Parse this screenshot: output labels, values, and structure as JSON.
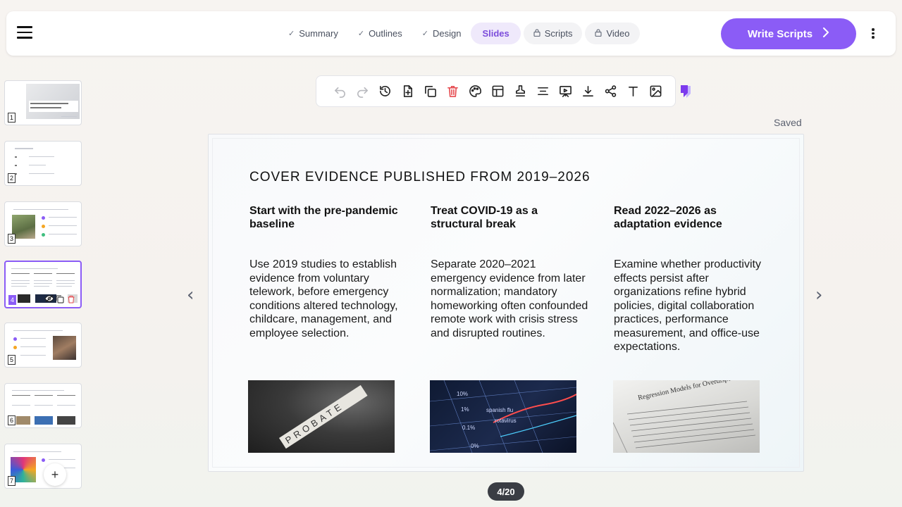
{
  "header": {
    "steps": [
      {
        "label": "Summary",
        "state": "done"
      },
      {
        "label": "Outlines",
        "state": "done"
      },
      {
        "label": "Design",
        "state": "done"
      },
      {
        "label": "Slides",
        "state": "active"
      },
      {
        "label": "Scripts",
        "state": "locked"
      },
      {
        "label": "Video",
        "state": "locked"
      }
    ],
    "write_button": "Write Scripts"
  },
  "thumbnails": {
    "numbers": [
      "1",
      "2",
      "3",
      "4",
      "5",
      "6",
      "7"
    ],
    "active": 4,
    "t1_title": "Remote Work's Impact on Employee Productivity"
  },
  "toolbar": {
    "icons": [
      "undo-icon",
      "redo-icon",
      "history-icon",
      "add-slide-icon",
      "duplicate-icon",
      "delete-icon",
      "palette-icon",
      "layout-icon",
      "stamp-icon",
      "align-icon",
      "present-icon",
      "download-icon",
      "share-icon",
      "text-icon",
      "image-icon"
    ]
  },
  "status": {
    "saved": "Saved"
  },
  "slide": {
    "title": "COVER EVIDENCE PUBLISHED FROM 2019–2026",
    "columns": [
      {
        "heading": "Start with the pre-pandemic baseline",
        "body": "Use 2019 studies to establish evidence from voluntary telework, before emergency conditions altered technology, childcare, management, and employee selection."
      },
      {
        "heading": "Treat COVID-19 as a structural break",
        "body": "Separate 2020–2021 emergency evidence from later normalization; mandatory homeworking often confounded remote work with crisis stress and disrupted routines."
      },
      {
        "heading": "Read 2022–2026 as adaptation evidence",
        "body": "Examine whether productivity effects persist after organizations refine hybrid policies, digital collaboration practices, performance measurement, and office-use expectations."
      }
    ],
    "image1_text": "PROBATE",
    "image3_text": "Regression Models for Overdispersed Count Response"
  },
  "nav": {
    "prev": "‹",
    "next": "›"
  },
  "pager": "4/20",
  "colors": {
    "accent": "#8b5cf6",
    "delete": "#e5484d",
    "pager_bg": "#3a3d44"
  }
}
